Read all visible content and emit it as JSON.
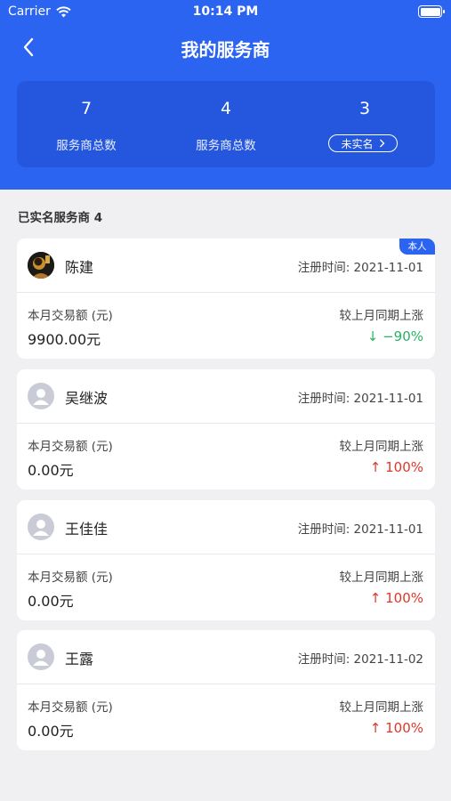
{
  "status_bar": {
    "carrier": "Carrier",
    "time": "10:14 PM"
  },
  "nav": {
    "title": "我的服务商"
  },
  "stats": [
    {
      "value": "7",
      "label": "服务商总数"
    },
    {
      "value": "4",
      "label": "服务商总数"
    },
    {
      "value": "3",
      "label": "未实名"
    }
  ],
  "section": {
    "title": "已实名服务商 4"
  },
  "providers": [
    {
      "name": "陈建",
      "reg_time": "注册时间: 2021-11-01",
      "badge": "本人",
      "amount_label": "本月交易额 (元)",
      "amount": "9900.00元",
      "change_label": "较上月同期上涨",
      "change": "↓ −90%",
      "direction": "down"
    },
    {
      "name": "吴继波",
      "reg_time": "注册时间: 2021-11-01",
      "amount_label": "本月交易额 (元)",
      "amount": "0.00元",
      "change_label": "较上月同期上涨",
      "change": "↑ 100%",
      "direction": "up"
    },
    {
      "name": "王佳佳",
      "reg_time": "注册时间: 2021-11-01",
      "amount_label": "本月交易额 (元)",
      "amount": "0.00元",
      "change_label": "较上月同期上涨",
      "change": "↑ 100%",
      "direction": "up"
    },
    {
      "name": "王露",
      "reg_time": "注册时间: 2021-11-02",
      "amount_label": "本月交易额 (元)",
      "amount": "0.00元",
      "change_label": "较上月同期上涨",
      "change": "↑ 100%",
      "direction": "up"
    }
  ],
  "colors": {
    "primary": "#2b64f0",
    "down": "#28b463",
    "up": "#e0362a"
  }
}
